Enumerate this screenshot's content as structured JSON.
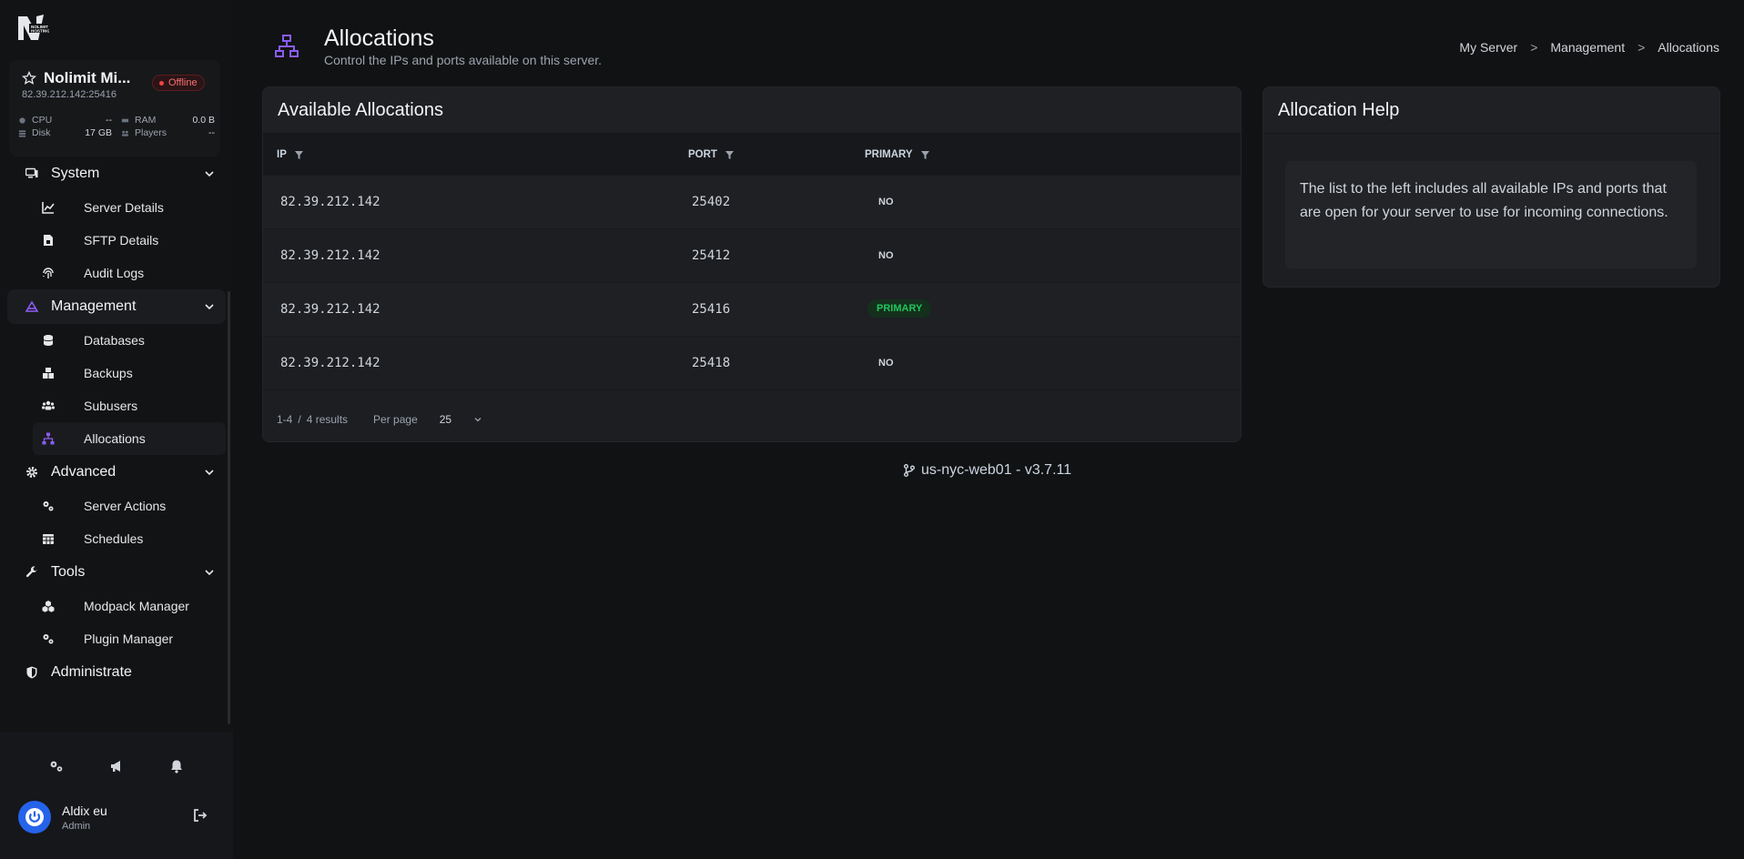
{
  "brand": {
    "logo_text": "NOLIMIT HOSTING"
  },
  "server": {
    "name": "Nolimit Mi...",
    "status": "Offline",
    "address": "82.39.212.142:25416",
    "stats": [
      {
        "label": "CPU",
        "value": "--",
        "icon": "cpu-icon"
      },
      {
        "label": "RAM",
        "value": "0.0 B",
        "icon": "ram-icon"
      },
      {
        "label": "Disk",
        "value": "17 GB",
        "icon": "disk-icon"
      },
      {
        "label": "Players",
        "value": "--",
        "icon": "players-icon"
      }
    ]
  },
  "nav": {
    "system": {
      "label": "System",
      "items": [
        "Server Details",
        "SFTP Details",
        "Audit Logs"
      ]
    },
    "management": {
      "label": "Management",
      "items": [
        "Databases",
        "Backups",
        "Subusers",
        "Allocations"
      ]
    },
    "advanced": {
      "label": "Advanced",
      "items": [
        "Server Actions",
        "Schedules"
      ]
    },
    "tools": {
      "label": "Tools",
      "items": [
        "Modpack Manager",
        "Plugin Manager"
      ]
    },
    "administrate": {
      "label": "Administrate"
    }
  },
  "user": {
    "name": "Aldix eu",
    "role": "Admin"
  },
  "page": {
    "title": "Allocations",
    "subtitle": "Control the IPs and ports available on this server.",
    "breadcrumb": [
      "My Server",
      "Management",
      "Allocations"
    ],
    "breadcrumb_sep": ">"
  },
  "allocations": {
    "title": "Available Allocations",
    "columns": [
      "IP",
      "PORT",
      "PRIMARY"
    ],
    "rows": [
      {
        "ip": "82.39.212.142",
        "port": "25402",
        "primary": "NO"
      },
      {
        "ip": "82.39.212.142",
        "port": "25412",
        "primary": "NO"
      },
      {
        "ip": "82.39.212.142",
        "port": "25416",
        "primary": "PRIMARY"
      },
      {
        "ip": "82.39.212.142",
        "port": "25418",
        "primary": "NO"
      }
    ],
    "pagination": {
      "range": "1-4",
      "sep": "/",
      "results": "4 results",
      "per_page_label": "Per page",
      "per_page_value": "25"
    }
  },
  "help": {
    "title": "Allocation Help",
    "text": "The list to the left includes all available IPs and ports that are open for your server to use for incoming connections."
  },
  "footer": {
    "node": "us-nyc-web01 - v3.7.11"
  },
  "colors": {
    "accent": "#8b5cf6",
    "primary_badge": "#22c55e",
    "offline": "#ef4444",
    "avatar": "#2563eb"
  }
}
